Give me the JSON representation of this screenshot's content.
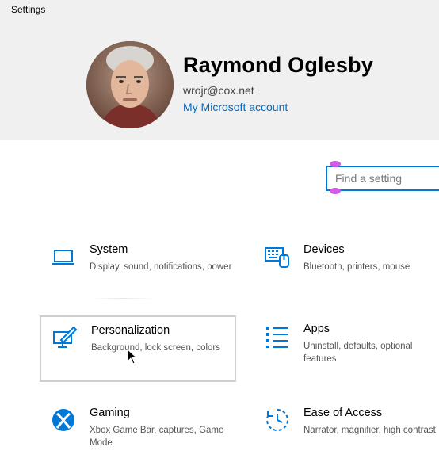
{
  "window": {
    "title": "Settings"
  },
  "account": {
    "name": "Raymond Oglesby",
    "email": "wrojr@cox.net",
    "link_label": "My Microsoft account"
  },
  "search": {
    "placeholder": "Find a setting"
  },
  "tiles": [
    {
      "title": "System",
      "description": "Display, sound, notifications, power",
      "icon": "laptop-icon"
    },
    {
      "title": "Devices",
      "description": "Bluetooth, printers, mouse",
      "icon": "keyboard-devices-icon"
    },
    {
      "title": "Personalization",
      "description": "Background, lock screen, colors",
      "icon": "personalization-icon"
    },
    {
      "title": "Apps",
      "description": "Uninstall, defaults, optional features",
      "icon": "apps-list-icon"
    },
    {
      "title": "Gaming",
      "description": "Xbox Game Bar, captures, Game Mode",
      "icon": "xbox-icon"
    },
    {
      "title": "Ease of Access",
      "description": "Narrator, magnifier, high contrast",
      "icon": "ease-of-access-icon"
    }
  ],
  "colors": {
    "accent": "#0078d7",
    "link": "#0067c0",
    "header_bg": "#f0f0f0",
    "selection_handle": "#d25ce6"
  }
}
